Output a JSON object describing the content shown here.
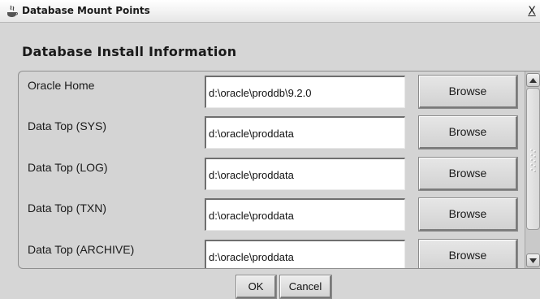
{
  "window": {
    "title": "Database Mount Points",
    "close_label": "X"
  },
  "section": {
    "title": "Database Install Information"
  },
  "rows": [
    {
      "label": "Oracle Home",
      "value": "d:\\oracle\\proddb\\9.2.0",
      "button": "Browse"
    },
    {
      "label": "Data Top (SYS)",
      "value": "d:\\oracle\\proddata",
      "button": "Browse"
    },
    {
      "label": "Data Top (LOG)",
      "value": "d:\\oracle\\proddata",
      "button": "Browse"
    },
    {
      "label": "Data Top (TXN)",
      "value": "d:\\oracle\\proddata",
      "button": "Browse"
    },
    {
      "label": "Data Top (ARCHIVE)",
      "value": "d:\\oracle\\proddata",
      "button": "Browse"
    }
  ],
  "scrollbar": {
    "up_icon": "scroll-up-arrow-icon",
    "down_icon": "scroll-down-arrow-icon"
  },
  "footer": {
    "ok_label": "OK",
    "cancel_label": "Cancel"
  }
}
